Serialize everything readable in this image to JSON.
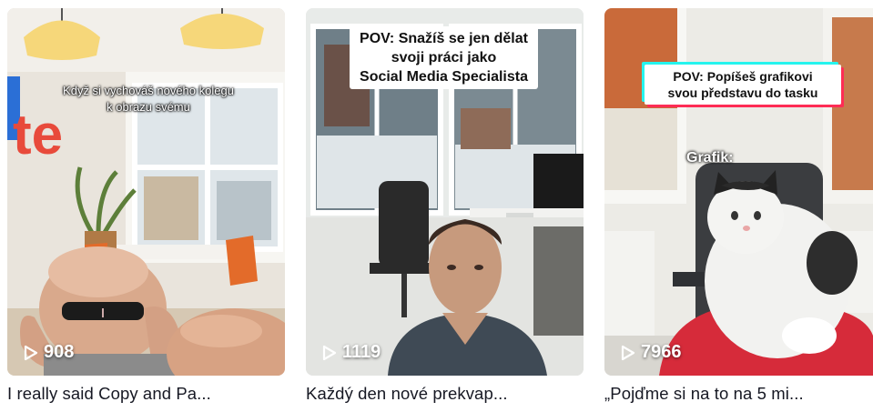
{
  "videos": [
    {
      "overlay_text": "Když si vychováš nového kolegu k obrazu svému",
      "views": "908",
      "title": "I really said Copy and Pa...",
      "play_icon": "play-outline-icon"
    },
    {
      "overlay_text_lines": [
        "POV: Snažíš se jen dělat",
        "svoji práci jako",
        "Social Media Specialista"
      ],
      "views": "1119",
      "title": "Každý den nové prekvap...",
      "play_icon": "play-outline-icon"
    },
    {
      "overlay_text_lines": [
        "POV: Popíšeš grafikovi",
        "svou představu do tasku"
      ],
      "overlay_label": "Grafik:",
      "views": "7966",
      "title": "„Pojďme si na to na 5 mi...",
      "play_icon": "play-outline-icon"
    }
  ]
}
